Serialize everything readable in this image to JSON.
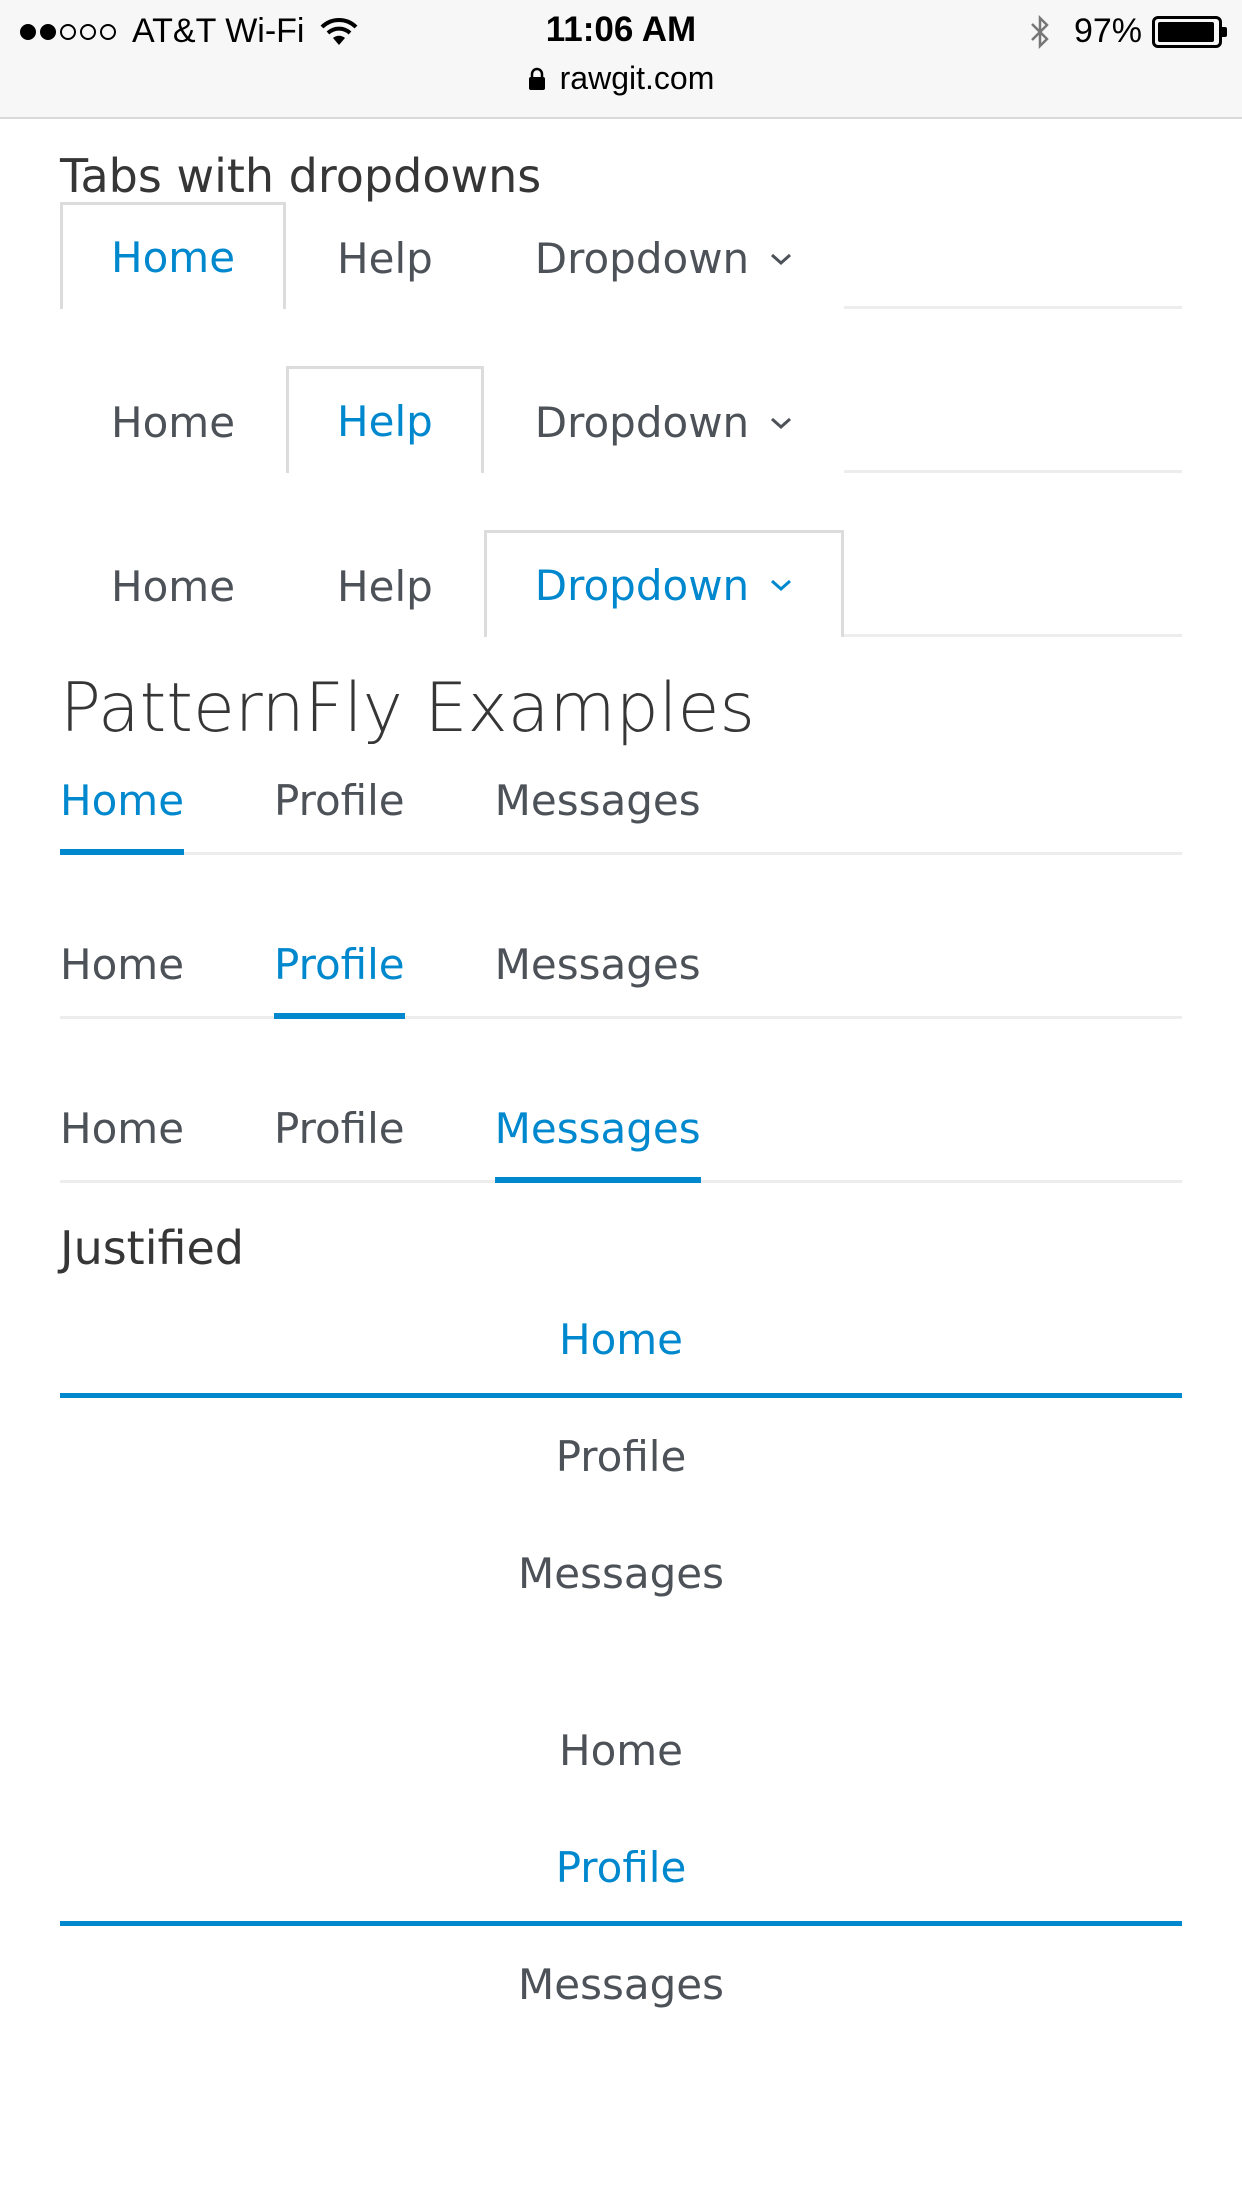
{
  "statusbar": {
    "carrier": "AT&T Wi-Fi",
    "time": "11:06 AM",
    "battery_pct": "97%",
    "battery_level": 0.97,
    "signal_bars": 2,
    "signal_total": 5,
    "url": "rawgit.com",
    "icons": [
      "wifi-icon",
      "bluetooth-icon",
      "battery-icon",
      "lock-icon"
    ]
  },
  "dropdown_section": {
    "title": "Tabs with dropdowns",
    "rows": [
      {
        "tabs": [
          {
            "label": "Home"
          },
          {
            "label": "Help"
          },
          {
            "label": "Dropdown"
          }
        ],
        "active": 0
      },
      {
        "tabs": [
          {
            "label": "Home"
          },
          {
            "label": "Help"
          },
          {
            "label": "Dropdown"
          }
        ],
        "active": 1
      },
      {
        "tabs": [
          {
            "label": "Home"
          },
          {
            "label": "Help"
          },
          {
            "label": "Dropdown"
          }
        ],
        "active": 2
      }
    ]
  },
  "patternfly_section": {
    "title": "PatternFly Examples",
    "rows": [
      {
        "tabs": [
          {
            "label": "Home"
          },
          {
            "label": "Profile"
          },
          {
            "label": "Messages"
          }
        ],
        "active": 0
      },
      {
        "tabs": [
          {
            "label": "Home"
          },
          {
            "label": "Profile"
          },
          {
            "label": "Messages"
          }
        ],
        "active": 1
      },
      {
        "tabs": [
          {
            "label": "Home"
          },
          {
            "label": "Profile"
          },
          {
            "label": "Messages"
          }
        ],
        "active": 2
      }
    ]
  },
  "justified_section": {
    "title": "Justified",
    "groups": [
      {
        "tabs": [
          {
            "label": "Home"
          },
          {
            "label": "Profile"
          },
          {
            "label": "Messages"
          }
        ],
        "active": 0
      },
      {
        "tabs": [
          {
            "label": "Home"
          },
          {
            "label": "Profile"
          },
          {
            "label": "Messages"
          }
        ],
        "active": 1
      }
    ]
  },
  "colors": {
    "accent": "#0088ce",
    "text": "#4d5258",
    "border": "#ededed"
  }
}
